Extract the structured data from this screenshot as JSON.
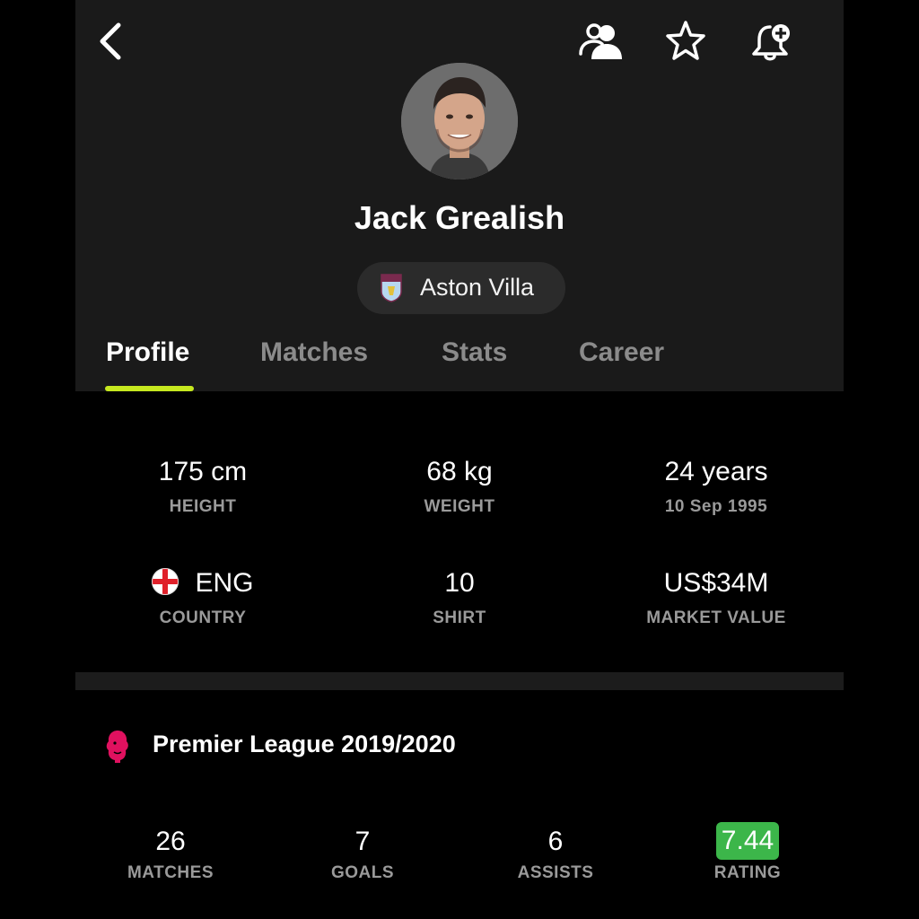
{
  "header": {
    "icons": [
      "back-chevron-icon",
      "people-icon",
      "star-icon",
      "bell-plus-icon"
    ]
  },
  "player": {
    "name": "Jack Grealish",
    "club": "Aston Villa",
    "club_badge": "AVFC",
    "photo": "player-photo"
  },
  "tabs": [
    {
      "label": "Profile",
      "active": true
    },
    {
      "label": "Matches",
      "active": false
    },
    {
      "label": "Stats",
      "active": false
    },
    {
      "label": "Career",
      "active": false
    }
  ],
  "profile": {
    "height": {
      "value": "175 cm",
      "label": "HEIGHT"
    },
    "weight": {
      "value": "68 kg",
      "label": "WEIGHT"
    },
    "age": {
      "value": "24 years",
      "label": "10 Sep 1995"
    },
    "country": {
      "value": "ENG",
      "label": "COUNTRY",
      "flag": "england-flag"
    },
    "shirt": {
      "value": "10",
      "label": "SHIRT"
    },
    "market_value": {
      "value": "US$34M",
      "label": "MARKET VALUE"
    }
  },
  "league": {
    "title": "Premier League 2019/2020",
    "icon": "premier-league-lion-icon",
    "stats": [
      {
        "value": "26",
        "label": "MATCHES"
      },
      {
        "value": "7",
        "label": "GOALS"
      },
      {
        "value": "6",
        "label": "ASSISTS"
      },
      {
        "value": "7.44",
        "label": "RATING"
      }
    ]
  },
  "colors": {
    "accent": "#c6e81f",
    "rating": "#3cb64a",
    "header_bg": "#1a1a1a",
    "league_icon": "#e0115f"
  }
}
